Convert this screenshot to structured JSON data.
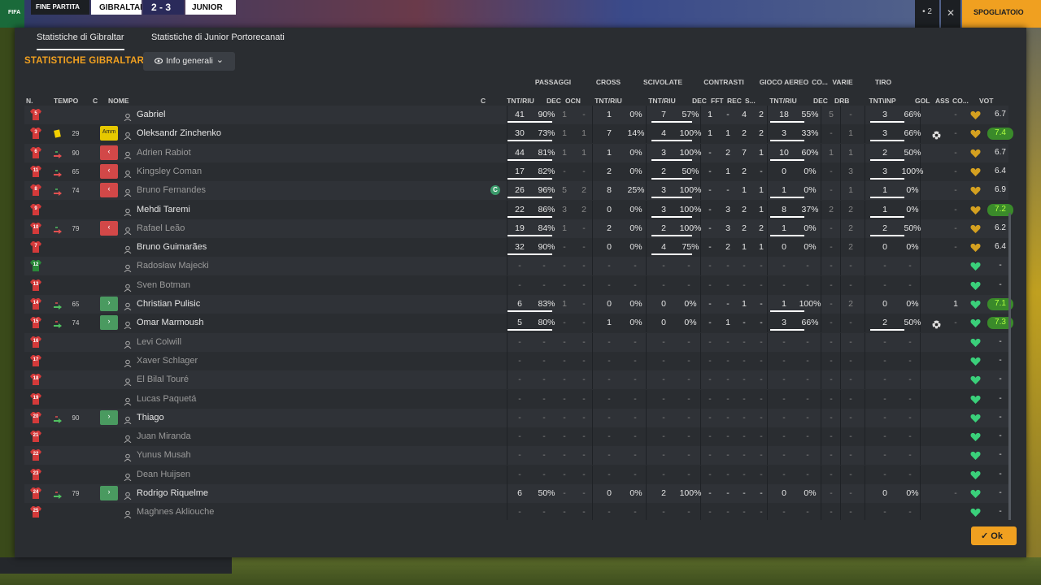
{
  "topbar": {
    "logo": "FIFA",
    "status": "FINE PARTITA",
    "team1": "GIBRALTAR",
    "score": "2 - 3",
    "team2": "JUNIOR",
    "dots": "• 2",
    "close": "✕",
    "action": "SPOGLIATOIO"
  },
  "tabs": [
    "Statistiche di Gibraltar",
    "Statistiche di Junior Portorecanati"
  ],
  "section_title": "STATISTICHE GIBRALTAR",
  "dropdown": {
    "label": "Info generali"
  },
  "groups": {
    "passaggi": "PASSAGGI",
    "cross": "CROSS",
    "scivolate": "SCIVOLATE",
    "contrasti": "CONTRASTI",
    "gioco_aereo": "GIOCO AEREO",
    "co": "CO...",
    "varie": "VARIE",
    "tiro": "TIRO"
  },
  "columns": {
    "n": "N.",
    "tempo": "TEMPO",
    "c": "C",
    "nome": "NOME",
    "c2": "C",
    "pass_tnt": "TNT/RIU",
    "pass_dec": "DEC",
    "pass_ocn": "OCN",
    "cross_tnt": "TNT/RIU",
    "sciv_tnt": "TNT/RIU",
    "con_dec": "DEC",
    "con_fft": "FFT",
    "con_rec": "REC",
    "con_s": "S...",
    "aereo_tnt": "TNT/RIU",
    "co_dec": "DEC",
    "var_drb": "DRB",
    "tiro_tnt": "TNT\\INP",
    "gol": "GOL",
    "ass": "ASS",
    "co2": "CO...",
    "vot": "VOT"
  },
  "colors": {
    "accent": "#f0a020",
    "shirt": "#d43a3a",
    "gk_shirt": "#2a8a3a",
    "heart_green": "#3ad07a",
    "heart_gold": "#d4a020"
  },
  "ok_label": "Ok",
  "players": [
    {
      "num": "5",
      "card": false,
      "sub": "",
      "min": "",
      "badge": "",
      "name": "Gabriel",
      "dim": false,
      "cap": false,
      "p": [
        "41",
        "90%"
      ],
      "pd": "1",
      "po": "-",
      "cr": [
        "1",
        "0%"
      ],
      "sc": [
        "7",
        "57%"
      ],
      "cd": "1",
      "cf": "-",
      "crc": "4",
      "cs": "2",
      "ae": [
        "18",
        "55%"
      ],
      "cod": "5",
      "drb": "-",
      "ti": [
        "3",
        "66%"
      ],
      "gol": "",
      "ass": "-",
      "heart": "gold",
      "vot": "6.7",
      "good": false
    },
    {
      "num": "3",
      "card": true,
      "sub": "",
      "min": "29",
      "badge": "amm",
      "badge_text": "Amm",
      "name": "Oleksandr Zinchenko",
      "dim": false,
      "cap": false,
      "p": [
        "30",
        "73%"
      ],
      "pd": "1",
      "po": "1",
      "cr": [
        "7",
        "14%"
      ],
      "sc": [
        "4",
        "100%"
      ],
      "cd": "1",
      "cf": "1",
      "crc": "2",
      "cs": "2",
      "ae": [
        "3",
        "33%"
      ],
      "cod": "-",
      "drb": "1",
      "ti": [
        "3",
        "66%"
      ],
      "gol": "ball",
      "ass": "-",
      "heart": "gold",
      "vot": "7.4",
      "good": true
    },
    {
      "num": "6",
      "card": false,
      "sub": "out",
      "min": "90",
      "badge": "out",
      "badge_text": "‹",
      "name": "Adrien Rabiot",
      "dim": true,
      "cap": false,
      "p": [
        "44",
        "81%"
      ],
      "pd": "1",
      "po": "1",
      "cr": [
        "1",
        "0%"
      ],
      "sc": [
        "3",
        "100%"
      ],
      "cd": "-",
      "cf": "2",
      "crc": "7",
      "cs": "1",
      "ae": [
        "10",
        "60%"
      ],
      "cod": "1",
      "drb": "1",
      "ti": [
        "2",
        "50%"
      ],
      "gol": "",
      "ass": "-",
      "heart": "gold",
      "vot": "6.7",
      "good": false
    },
    {
      "num": "11",
      "card": false,
      "sub": "out",
      "min": "65",
      "badge": "out",
      "badge_text": "‹",
      "name": "Kingsley Coman",
      "dim": true,
      "cap": false,
      "p": [
        "17",
        "82%"
      ],
      "pd": "-",
      "po": "-",
      "cr": [
        "2",
        "0%"
      ],
      "sc": [
        "2",
        "50%"
      ],
      "cd": "-",
      "cf": "1",
      "crc": "2",
      "cs": "-",
      "ae": [
        "0",
        "0%"
      ],
      "cod": "-",
      "drb": "3",
      "ti": [
        "3",
        "100%"
      ],
      "gol": "",
      "ass": "-",
      "heart": "gold",
      "vot": "6.4",
      "good": false
    },
    {
      "num": "8",
      "card": false,
      "sub": "out",
      "min": "74",
      "badge": "out",
      "badge_text": "‹",
      "name": "Bruno Fernandes",
      "dim": true,
      "cap": true,
      "p": [
        "26",
        "96%"
      ],
      "pd": "5",
      "po": "2",
      "cr": [
        "8",
        "25%"
      ],
      "sc": [
        "3",
        "100%"
      ],
      "cd": "-",
      "cf": "-",
      "crc": "1",
      "cs": "1",
      "ae": [
        "1",
        "0%"
      ],
      "cod": "-",
      "drb": "1",
      "ti": [
        "1",
        "0%"
      ],
      "gol": "",
      "ass": "-",
      "heart": "gold",
      "vot": "6.9",
      "good": false
    },
    {
      "num": "9",
      "card": false,
      "sub": "",
      "min": "",
      "badge": "",
      "name": "Mehdi Taremi",
      "dim": false,
      "cap": false,
      "p": [
        "22",
        "86%"
      ],
      "pd": "3",
      "po": "2",
      "cr": [
        "0",
        "0%"
      ],
      "sc": [
        "3",
        "100%"
      ],
      "cd": "-",
      "cf": "3",
      "crc": "2",
      "cs": "1",
      "ae": [
        "8",
        "37%"
      ],
      "cod": "2",
      "drb": "2",
      "ti": [
        "1",
        "0%"
      ],
      "gol": "",
      "ass": "-",
      "heart": "gold",
      "vot": "7.2",
      "good": true
    },
    {
      "num": "10",
      "card": false,
      "sub": "out",
      "min": "79",
      "badge": "out",
      "badge_text": "‹",
      "name": "Rafael Leão",
      "dim": true,
      "cap": false,
      "p": [
        "19",
        "84%"
      ],
      "pd": "1",
      "po": "-",
      "cr": [
        "2",
        "0%"
      ],
      "sc": [
        "2",
        "100%"
      ],
      "cd": "-",
      "cf": "3",
      "crc": "2",
      "cs": "2",
      "ae": [
        "1",
        "0%"
      ],
      "cod": "-",
      "drb": "2",
      "ti": [
        "2",
        "50%"
      ],
      "gol": "",
      "ass": "-",
      "heart": "gold",
      "vot": "6.2",
      "good": false
    },
    {
      "num": "7",
      "card": false,
      "sub": "",
      "min": "",
      "badge": "",
      "name": "Bruno Guimarães",
      "dim": false,
      "cap": false,
      "p": [
        "32",
        "90%"
      ],
      "pd": "-",
      "po": "-",
      "cr": [
        "0",
        "0%"
      ],
      "sc": [
        "4",
        "75%"
      ],
      "cd": "-",
      "cf": "2",
      "crc": "1",
      "cs": "1",
      "ae": [
        "0",
        "0%"
      ],
      "cod": "-",
      "drb": "2",
      "ti": [
        "0",
        "0%"
      ],
      "gol": "",
      "ass": "-",
      "heart": "gold",
      "vot": "6.4",
      "good": false
    },
    {
      "num": "12",
      "gk": true,
      "card": false,
      "sub": "",
      "min": "",
      "badge": "",
      "name": "Radosław Majecki",
      "dim": true,
      "cap": false,
      "empty": true,
      "heart": "green",
      "vot": "-"
    },
    {
      "num": "13",
      "card": false,
      "sub": "",
      "min": "",
      "badge": "",
      "name": "Sven Botman",
      "dim": true,
      "cap": false,
      "empty": true,
      "heart": "green",
      "vot": "-"
    },
    {
      "num": "14",
      "card": false,
      "sub": "in",
      "min": "65",
      "badge": "in",
      "badge_text": "›",
      "name": "Christian Pulisic",
      "dim": false,
      "cap": false,
      "p": [
        "6",
        "83%"
      ],
      "pd": "1",
      "po": "-",
      "cr": [
        "0",
        "0%"
      ],
      "sc": [
        "0",
        "0%"
      ],
      "cd": "-",
      "cf": "-",
      "crc": "1",
      "cs": "-",
      "ae": [
        "1",
        "100%"
      ],
      "cod": "-",
      "drb": "2",
      "ti": [
        "0",
        "0%"
      ],
      "gol": "",
      "ass": "1",
      "heart": "green",
      "vot": "7.1",
      "good": true
    },
    {
      "num": "15",
      "card": false,
      "sub": "in",
      "min": "74",
      "badge": "in",
      "badge_text": "›",
      "name": "Omar Marmoush",
      "dim": false,
      "cap": false,
      "p": [
        "5",
        "80%"
      ],
      "pd": "-",
      "po": "-",
      "cr": [
        "1",
        "0%"
      ],
      "sc": [
        "0",
        "0%"
      ],
      "cd": "-",
      "cf": "1",
      "crc": "-",
      "cs": "-",
      "ae": [
        "3",
        "66%"
      ],
      "cod": "-",
      "drb": "-",
      "ti": [
        "2",
        "50%"
      ],
      "gol": "ball",
      "ass": "-",
      "heart": "green",
      "vot": "7.3",
      "good": true
    },
    {
      "num": "16",
      "card": false,
      "sub": "",
      "min": "",
      "badge": "",
      "name": "Levi Colwill",
      "dim": true,
      "cap": false,
      "empty": true,
      "heart": "green",
      "vot": "-"
    },
    {
      "num": "17",
      "card": false,
      "sub": "",
      "min": "",
      "badge": "",
      "name": "Xaver Schlager",
      "dim": true,
      "cap": false,
      "empty": true,
      "heart": "green",
      "vot": "-"
    },
    {
      "num": "18",
      "card": false,
      "sub": "",
      "min": "",
      "badge": "",
      "name": "El Bilal Touré",
      "dim": true,
      "cap": false,
      "empty": true,
      "heart": "green",
      "vot": "-"
    },
    {
      "num": "19",
      "card": false,
      "sub": "",
      "min": "",
      "badge": "",
      "name": "Lucas Paquetá",
      "dim": true,
      "cap": false,
      "empty": true,
      "heart": "green",
      "vot": "-"
    },
    {
      "num": "20",
      "card": false,
      "sub": "in",
      "min": "90",
      "badge": "in",
      "badge_text": "›",
      "name": "Thiago",
      "dim": false,
      "cap": false,
      "empty": true,
      "heart": "green",
      "vot": "-"
    },
    {
      "num": "21",
      "card": false,
      "sub": "",
      "min": "",
      "badge": "",
      "name": "Juan Miranda",
      "dim": true,
      "cap": false,
      "empty": true,
      "heart": "green",
      "vot": "-"
    },
    {
      "num": "22",
      "card": false,
      "sub": "",
      "min": "",
      "badge": "",
      "name": "Yunus Musah",
      "dim": true,
      "cap": false,
      "empty": true,
      "heart": "green",
      "vot": "-"
    },
    {
      "num": "23",
      "card": false,
      "sub": "",
      "min": "",
      "badge": "",
      "name": "Dean Huijsen",
      "dim": true,
      "cap": false,
      "empty": true,
      "heart": "green",
      "vot": "-"
    },
    {
      "num": "24",
      "card": false,
      "sub": "in",
      "min": "79",
      "badge": "in",
      "badge_text": "›",
      "name": "Rodrigo Riquelme",
      "dim": false,
      "cap": false,
      "p": [
        "6",
        "50%"
      ],
      "pd": "-",
      "po": "-",
      "cr": [
        "0",
        "0%"
      ],
      "sc": [
        "2",
        "100%"
      ],
      "cd": "-",
      "cf": "-",
      "crc": "-",
      "cs": "-",
      "ae": [
        "0",
        "0%"
      ],
      "cod": "-",
      "drb": "-",
      "ti": [
        "0",
        "0%"
      ],
      "gol": "",
      "ass": "-",
      "heart": "green",
      "vot": "-",
      "good": false,
      "nobar": true
    },
    {
      "num": "25",
      "card": false,
      "sub": "",
      "min": "",
      "badge": "",
      "name": "Maghnes Akliouche",
      "dim": true,
      "cap": false,
      "empty": true,
      "heart": "green",
      "vot": "-"
    }
  ]
}
